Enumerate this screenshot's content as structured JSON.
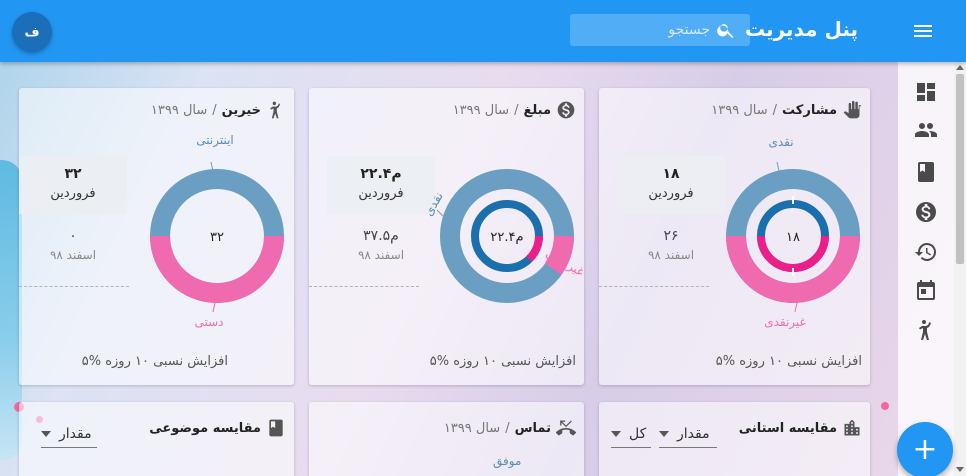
{
  "header": {
    "title": "پنل مدیریت",
    "search_placeholder": "جستجو",
    "avatar_letter": "ف"
  },
  "rail": [
    "dashboard-icon",
    "people-icon",
    "book-icon",
    "dollar-icon",
    "history-icon",
    "calendar-icon",
    "person-raised-icon"
  ],
  "cards": [
    {
      "title": "مشارکت",
      "sub": "سال ۱۳۹۹",
      "icon": "hand-icon",
      "stat_value": "۱۸",
      "stat_label": "فروردین",
      "prev_value": "۲۶",
      "prev_label": "اسفند ۹۸",
      "footer": "۵% افزایش نسبی ۱۰ روزه",
      "center": "۱۸",
      "slice_a": "نقدی",
      "slice_b": "غیرنقدی"
    },
    {
      "title": "مبلغ",
      "sub": "سال ۱۳۹۹",
      "icon": "dollar-icon",
      "stat_value": "۲۲.۴م",
      "stat_label": "فروردین",
      "prev_value": "۳۷.۵م",
      "prev_label": "اسفند ۹۸",
      "footer": "۵% افزایش نسبی ۱۰ روزه",
      "center": "۲۲.۴م",
      "slice_a": "نقدی",
      "slice_b": "غیرنقدی"
    },
    {
      "title": "خیرین",
      "sub": "سال ۱۳۹۹",
      "icon": "person-raised-icon",
      "stat_value": "۳۲",
      "stat_label": "فروردین",
      "prev_value": "۰",
      "prev_label": "اسفند ۹۸",
      "footer": "۵% افزایش نسبی ۱۰ روزه",
      "center": "۳۲",
      "slice_a": "اینترنتی",
      "slice_b": "دستی"
    }
  ],
  "bottom_cards": {
    "province": {
      "title": "مقایسه استانی",
      "icon": "building-icon",
      "dropdown_1": "مقدار",
      "dropdown_2": "کل"
    },
    "contact": {
      "title": "تماس",
      "sub": "سال ۱۳۹۹",
      "icon": "phone-missed-icon",
      "partial_label": "موفق"
    },
    "topic": {
      "title": "مقایسه موضوعی",
      "icon": "book-icon",
      "dropdown_1": "مقدار"
    }
  },
  "colors": {
    "primary": "#2196f3",
    "donut_blue": "#6a9ec3",
    "donut_pink": "#f06ab0",
    "inner_blue": "#1a6fad",
    "inner_pink": "#ec1f8a"
  }
}
